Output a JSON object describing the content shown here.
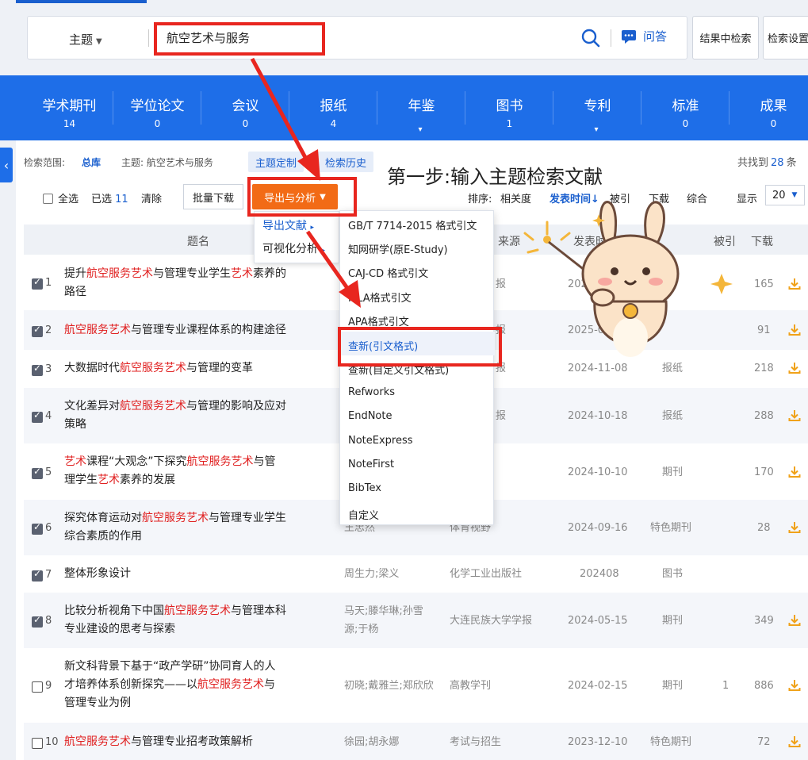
{
  "search": {
    "field": "主题",
    "query": "航空艺术与服务",
    "qa_label": "问答",
    "in_results": "结果中检索",
    "settings": "检索设置"
  },
  "categories": [
    {
      "name": "学术期刊",
      "count": "14"
    },
    {
      "name": "学位论文",
      "count": "0"
    },
    {
      "name": "会议",
      "count": "0"
    },
    {
      "name": "报纸",
      "count": "4"
    },
    {
      "name": "年鉴",
      "count": ""
    },
    {
      "name": "图书",
      "count": "1"
    },
    {
      "name": "专利",
      "count": ""
    },
    {
      "name": "标准",
      "count": "0"
    },
    {
      "name": "成果",
      "count": "0"
    }
  ],
  "scope": {
    "label": "检索范围:",
    "library": "总库",
    "topic": "主题: 航空艺术与服务",
    "customize": "主题定制",
    "history": "检索历史",
    "found_prefix": "共找到",
    "found_count": "28",
    "found_suffix": "条"
  },
  "annotation": "第一步:输入主题检索文献",
  "toolbar": {
    "select_all": "全选",
    "selected_label": "已选",
    "selected_count": "11",
    "clear": "清除",
    "batch_download": "批量下载",
    "export_analysis": "导出与分析",
    "sort_label": "排序:",
    "sort_relevance": "相关度",
    "sort_date": "发表时间",
    "sort_cited": "被引",
    "sort_download": "下载",
    "sort_overall": "综合",
    "display_label": "显示",
    "page_size": "20"
  },
  "submenu": {
    "export_docs": "导出文献",
    "visual_analysis": "可视化分析"
  },
  "export_menu": [
    "GB/T 7714-2015 格式引文",
    "知网研学(原E-Study)",
    "CAJ-CD 格式引文",
    "MLA格式引文",
    "APA格式引文",
    "查新(引文格式)",
    "查新(自定义引文格式)",
    "Refworks",
    "EndNote",
    "NoteExpress",
    "NoteFirst",
    "BibTex",
    "自定义"
  ],
  "table_headers": {
    "title": "题名",
    "source": "来源",
    "date": "发表时间",
    "cited": "被引",
    "downloads": "下载"
  },
  "rows": [
    {
      "n": "1",
      "title_parts": [
        "提升",
        "航空服务艺术",
        "与管理专业学生",
        "艺术",
        "素养的"
      ],
      "title_line2": "路径",
      "authors": "",
      "source": "报",
      "date": "2025-02-2",
      "db": "",
      "cited": "",
      "downloads": "165"
    },
    {
      "n": "2",
      "title_parts": [
        "",
        "航空服务艺术",
        "与管理专业课程体系的构建途径"
      ],
      "authors": "",
      "source": "报",
      "date": "2025-02-18",
      "db": "",
      "cited": "",
      "downloads": "91"
    },
    {
      "n": "3",
      "title_parts": [
        "大数据时代",
        "航空服务艺术",
        "与管理的变革"
      ],
      "authors": "",
      "source": "报",
      "date": "2024-11-08",
      "db": "报纸",
      "cited": "",
      "downloads": "218"
    },
    {
      "n": "4",
      "title_parts": [
        "文化差异对",
        "航空服务艺术",
        "与管理的影响及应对"
      ],
      "title_line2": "策略",
      "authors": "",
      "source": "报",
      "date": "2024-10-18",
      "db": "报纸",
      "cited": "",
      "downloads": "288"
    },
    {
      "n": "5",
      "title_parts": [
        "",
        "艺术",
        "课程“大观念”下探究",
        "航空服务艺术",
        "与管"
      ],
      "title_line2_parts": [
        "理学生",
        "艺术",
        "素养的发展"
      ],
      "authors": "",
      "source": "",
      "date": "2024-10-10",
      "db": "期刊",
      "cited": "",
      "downloads": "170"
    },
    {
      "n": "6",
      "title_parts": [
        "探究体育运动对",
        "航空服务艺术",
        "与管理专业学生"
      ],
      "title_line2": "综合素质的作用",
      "authors": "王忠然",
      "source": "体育视野",
      "date": "2024-09-16",
      "db": "特色期刊",
      "cited": "",
      "downloads": "28"
    },
    {
      "n": "7",
      "title_parts": [
        "整体形象设计"
      ],
      "authors": "周生力;梁义",
      "source": "化学工业出版社",
      "date": "202408",
      "db": "图书",
      "cited": "",
      "downloads": ""
    },
    {
      "n": "8",
      "title_parts": [
        "比较分析视角下中国",
        "航空服务艺术",
        "与管理本科"
      ],
      "title_line2": "专业建设的思考与探索",
      "authors": "马天;滕华琳;孙雪",
      "authors2": "源;于杨",
      "source": "大连民族大学学报",
      "date": "2024-05-15",
      "db": "期刊",
      "cited": "",
      "downloads": "349"
    },
    {
      "n": "9",
      "title_parts": [
        "新文科背景下基于“政产学研”协同育人的人"
      ],
      "title_line2": "才培养体系创新探究——以",
      "title_line3_parts": [
        "",
        "航空服务艺术",
        "与"
      ],
      "title_line4": "管理专业为例",
      "authors": "初晓;戴雅兰;郑欣欣",
      "source": "高教学刊",
      "date": "2024-02-15",
      "db": "期刊",
      "cited": "1",
      "downloads": "886"
    },
    {
      "n": "10",
      "title_parts": [
        "",
        "航空服务艺术",
        "与管理专业招考政策解析"
      ],
      "authors": "徐园;胡永娜",
      "source": "考试与招生",
      "date": "2023-12-10",
      "db": "特色期刊",
      "cited": "",
      "downloads": "72"
    }
  ],
  "colors": {
    "brand_blue": "#1e6ee8",
    "link_blue": "#1a5fce",
    "export_orange": "#f26b16",
    "highlight_red": "#e02020",
    "annotation_red": "#e8261f",
    "download_icon": "#f0a21a"
  }
}
